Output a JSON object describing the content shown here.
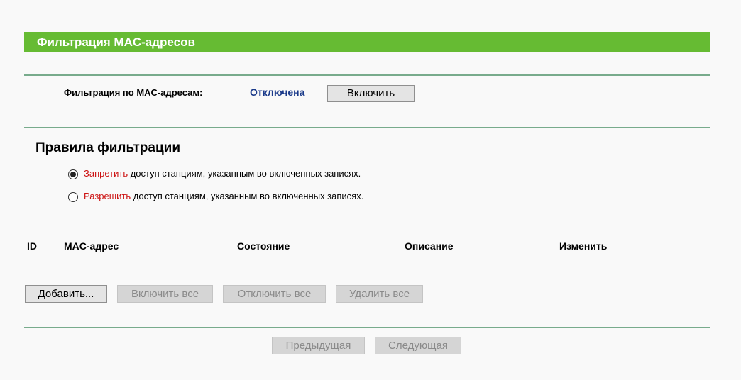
{
  "header": {
    "title": "Фильтрация MAC-адресов"
  },
  "mac_filter": {
    "label": "Фильтрация по MAC-адресам:",
    "status": "Отключена",
    "enable_button": "Включить"
  },
  "rules": {
    "heading": "Правила фильтрации",
    "deny": {
      "keyword": "Запретить",
      "text": " доступ станциям, указанным во включенных записях.",
      "checked": true
    },
    "allow": {
      "keyword": "Разрешить",
      "text": " доступ станциям, указанным во включенных записях.",
      "checked": false
    }
  },
  "table": {
    "columns": [
      "ID",
      "MAC-адрес",
      "Состояние",
      "Описание",
      "Изменить"
    ],
    "rows": []
  },
  "actions": {
    "add": "Добавить...",
    "enable_all": "Включить все",
    "disable_all": "Отключить все",
    "delete_all": "Удалить все"
  },
  "pagination": {
    "prev": "Предыдущая",
    "next": "Следующая"
  },
  "colors": {
    "title_bar": "#66bb33",
    "divider": "#78ab8c",
    "status_text": "#1a3a8a",
    "keyword_red": "#cc1111"
  }
}
